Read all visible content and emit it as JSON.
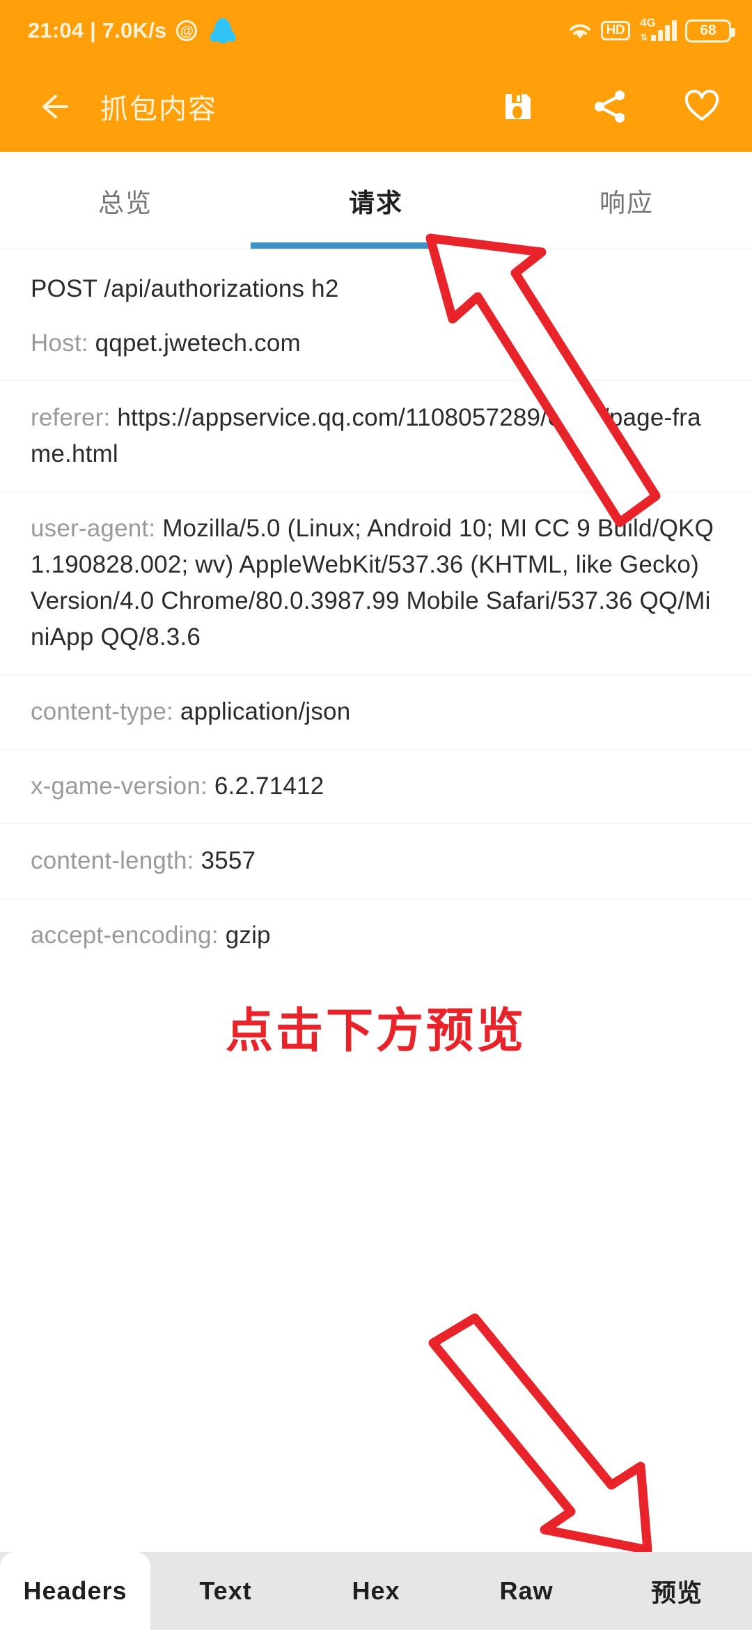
{
  "statusbar": {
    "clock_text": "21:04 | 7.0K/s",
    "at_icon": "at-circle-icon",
    "qq_icon": "qq-penguin-icon",
    "wifi_icon": "wifi-icon",
    "hd_label": "HD",
    "network_label": "4G",
    "network_arrows": "⇅",
    "battery_level": "68"
  },
  "toolbar": {
    "back_icon": "back-arrow-icon",
    "title": "抓包内容",
    "save_icon": "save-floppy-icon",
    "share_icon": "share-icon",
    "favorite_icon": "heart-icon"
  },
  "tabs": {
    "items": [
      {
        "label": "总览",
        "active": false
      },
      {
        "label": "请求",
        "active": true
      },
      {
        "label": "响应",
        "active": false
      }
    ],
    "indicator_color": "#3D92C8"
  },
  "request": {
    "request_line": "POST /api/authorizations h2",
    "headers": [
      {
        "key": "Host",
        "value": "qqpet.jwetech.com"
      },
      {
        "key": "referer",
        "value": "https://appservice.qq.com/1108057289/6.5.6/page-frame.html"
      },
      {
        "key": "user-agent",
        "value": "Mozilla/5.0 (Linux; Android 10; MI CC 9 Build/QKQ1.190828.002; wv) AppleWebKit/537.36 (KHTML, like Gecko) Version/4.0 Chrome/80.0.3987.99 Mobile Safari/537.36 QQ/MiniApp QQ/8.3.6"
      },
      {
        "key": "content-type",
        "value": "application/json"
      },
      {
        "key": "x-game-version",
        "value": "6.2.71412"
      },
      {
        "key": "content-length",
        "value": "3557"
      },
      {
        "key": "accept-encoding",
        "value": "gzip"
      }
    ]
  },
  "annotations": {
    "hint_text": "点击下方预览",
    "hint_color": "#E8232A",
    "arrow_top_icon": "red-arrow-up-left-icon",
    "arrow_bottom_icon": "red-arrow-down-right-icon"
  },
  "bottom_tabs": {
    "items": [
      {
        "label": "Headers",
        "active": true
      },
      {
        "label": "Text",
        "active": false
      },
      {
        "label": "Hex",
        "active": false
      },
      {
        "label": "Raw",
        "active": false
      },
      {
        "label": "预览",
        "active": false
      }
    ]
  }
}
